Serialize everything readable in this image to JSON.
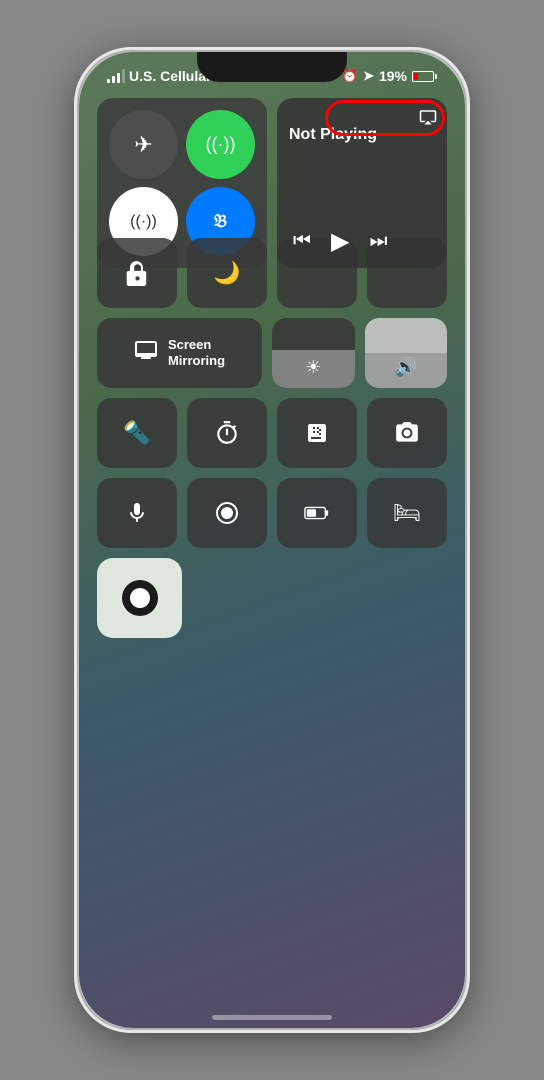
{
  "phone": {
    "status_bar": {
      "carrier": "U.S. Cellular LTE",
      "battery_percent": "19%",
      "alarm_icon": "⏰",
      "location_icon": "✈",
      "battery_low": true
    },
    "control_center": {
      "connectivity": {
        "airplane_mode": false,
        "wifi": true,
        "cellular": false,
        "bluetooth": true
      },
      "media": {
        "status": "Not Playing",
        "airplay": "AirPlay"
      },
      "screen_mirroring": "Screen\nMirroring",
      "brightness_label": "☀",
      "volume_label": "🔊"
    },
    "tools": {
      "flashlight": "🔦",
      "timer": "⏱",
      "calculator": "🧮",
      "camera": "📷",
      "voice_memos": "🎙",
      "screen_record": "⏺",
      "battery": "🔋",
      "bed": "🛏",
      "accessibility": "⬤"
    },
    "home_indicator": true
  }
}
